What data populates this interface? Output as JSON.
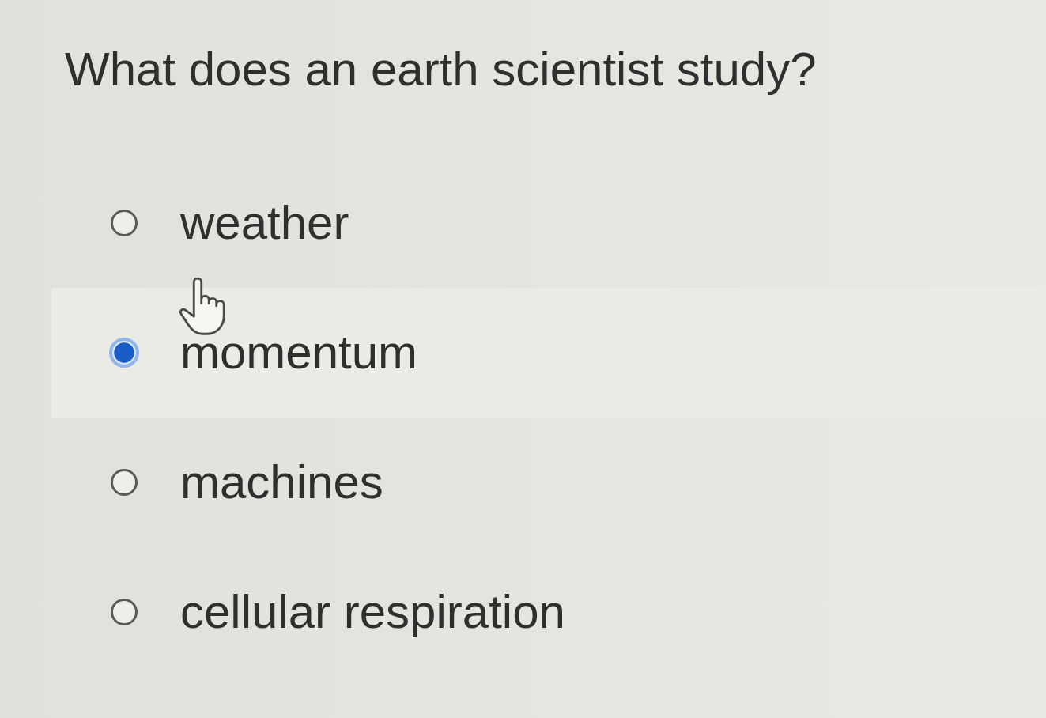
{
  "question": {
    "text": "What does an earth scientist study?"
  },
  "options": [
    {
      "label": "weather",
      "selected": false,
      "hovered": false
    },
    {
      "label": "momentum",
      "selected": true,
      "hovered": true
    },
    {
      "label": "machines",
      "selected": false,
      "hovered": false
    },
    {
      "label": "cellular respiration",
      "selected": false,
      "hovered": false
    }
  ]
}
